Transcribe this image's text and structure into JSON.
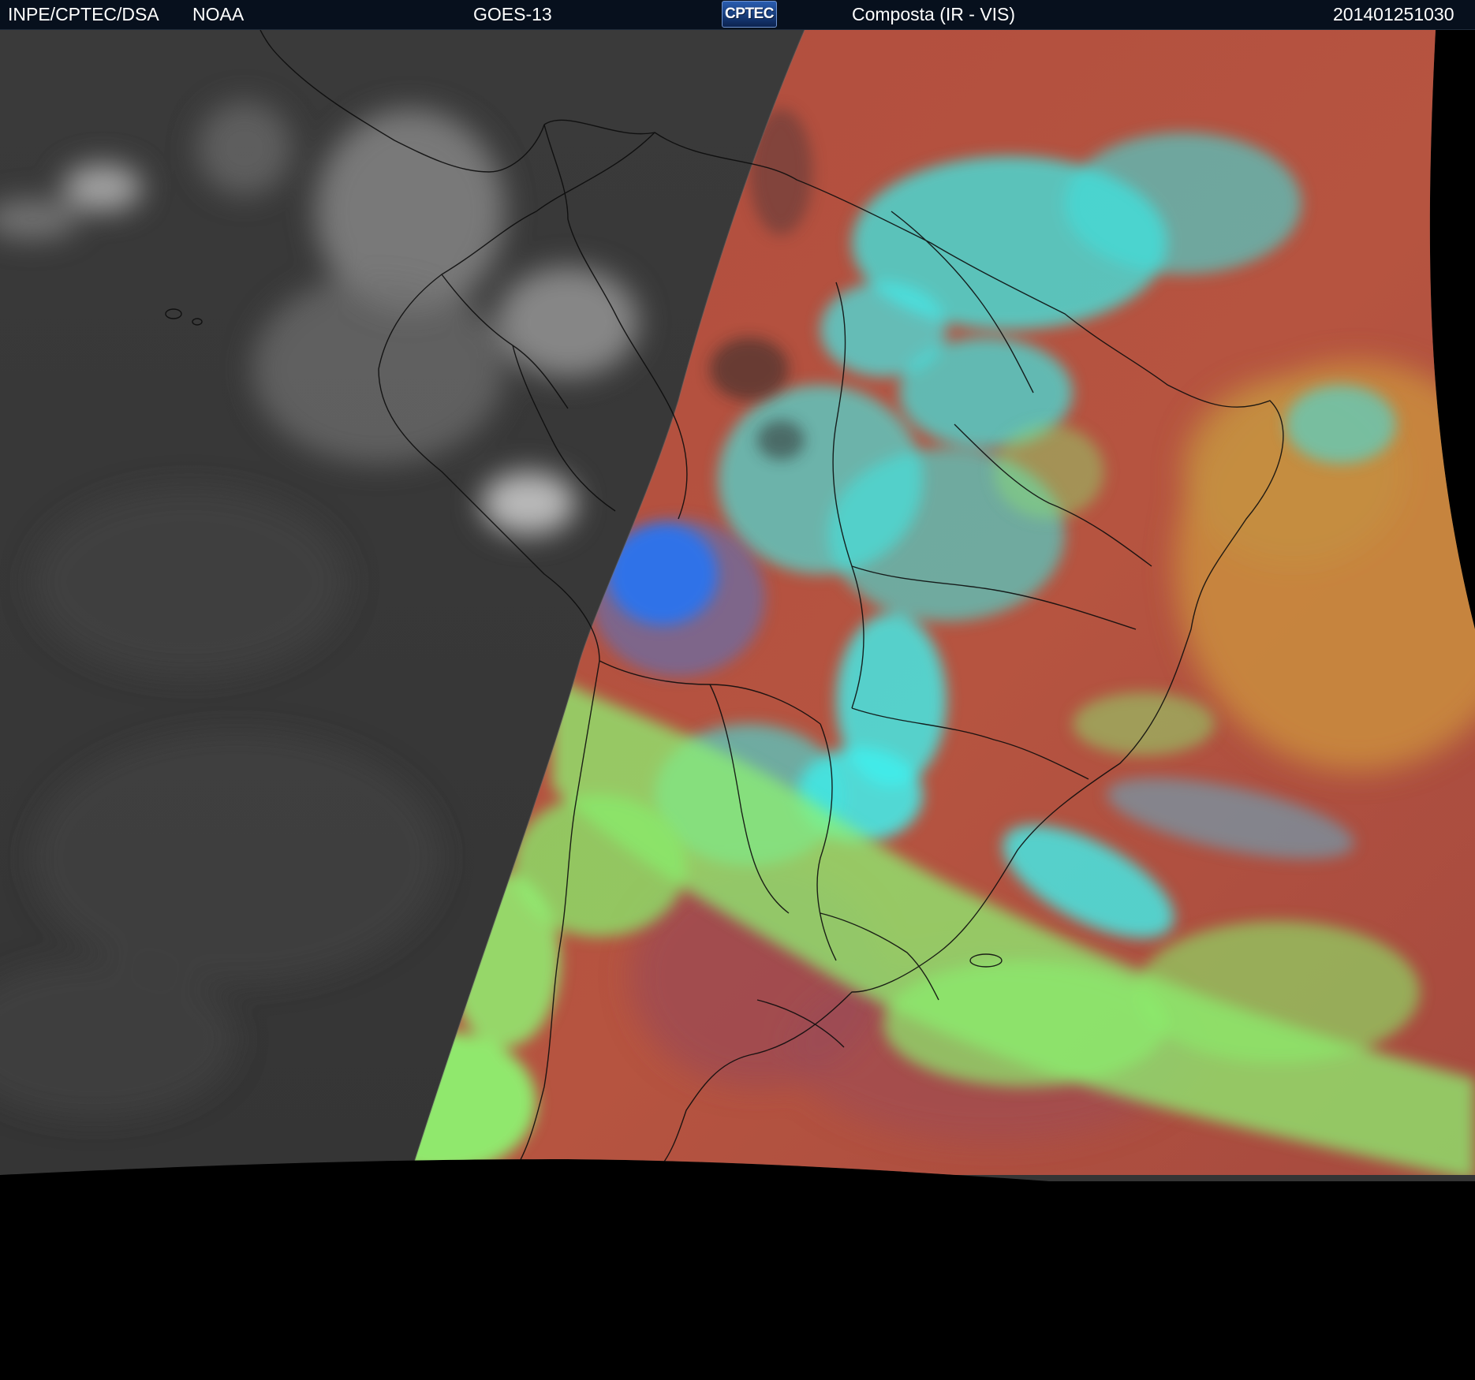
{
  "header": {
    "institution": "INPE/CPTEC/DSA",
    "agency": "NOAA",
    "satellite": "GOES-13",
    "logo_text": "CPTEC",
    "product": "Composta (IR - VIS)",
    "timestamp": "201401251030"
  },
  "colors": {
    "header_bg": "#07101d",
    "night_side": "#3c3c3c",
    "ocean_day": "#b5523f",
    "cloud_cyan": "#3ff0ec",
    "cloud_green": "#86f06a",
    "deep_convection_blue": "#1f6df2",
    "ocean_orange": "#c8863c",
    "space": "#000000"
  },
  "icons": {
    "logo": "cptec-logo"
  }
}
